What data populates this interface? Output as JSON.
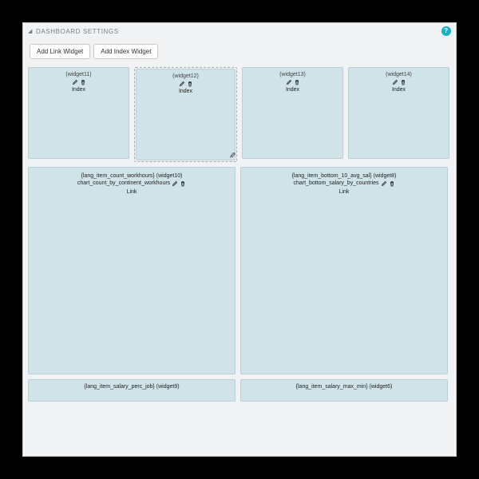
{
  "header": {
    "title": "DASHBOARD SETTINGS",
    "help_char": "?"
  },
  "toolbar": {
    "add_link_label": "Add Link Widget",
    "add_index_label": "Add Index Widget"
  },
  "type_labels": {
    "index": "Index",
    "link": "Link"
  },
  "row1": [
    {
      "id": "(widget11)",
      "type": "index"
    },
    {
      "id": "(widget12)",
      "type": "index",
      "selected": true
    },
    {
      "id": "(widget13)",
      "type": "index"
    },
    {
      "id": "(widget14)",
      "type": "index"
    }
  ],
  "row2": [
    {
      "lang": "{lang_item_count_workhours}",
      "id": "(widget10)",
      "subtitle": "chart_count_by_continent_workhours",
      "type": "link"
    },
    {
      "lang": "{lang_item_bottom_10_avg_sal}",
      "id": "(widget8)",
      "subtitle": "chart_bottom_salary_by_countries",
      "type": "link"
    }
  ],
  "row3": [
    {
      "lang": "{lang_item_salary_perc_job}",
      "id": "(widget9)"
    },
    {
      "lang": "{lang_item_salary_max_min}",
      "id": "(widget6)"
    }
  ]
}
